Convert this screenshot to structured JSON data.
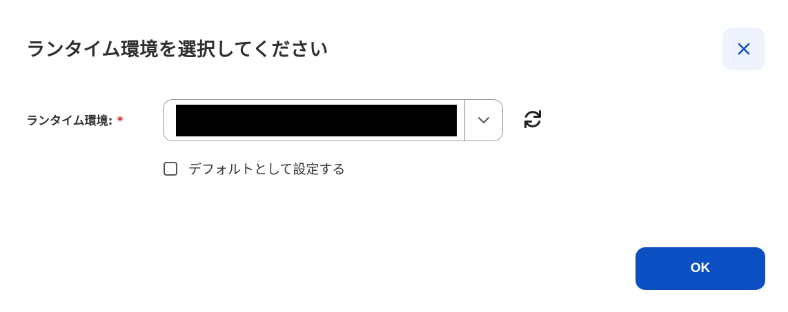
{
  "dialog": {
    "title": "ランタイム環境を選択してください",
    "close_icon": "close-icon",
    "runtime_field": {
      "label": "ランタイム環境:",
      "required_marker": "*",
      "selected_value": "",
      "dropdown_icon": "chevron-down-icon",
      "refresh_icon": "refresh-icon"
    },
    "default_checkbox": {
      "label": "デフォルトとして設定する",
      "checked": false
    },
    "ok_button": "OK"
  },
  "colors": {
    "primary": "#0b4fc2",
    "required": "#e02424",
    "close_bg": "#eef3fd",
    "border": "#9a9a9a"
  }
}
